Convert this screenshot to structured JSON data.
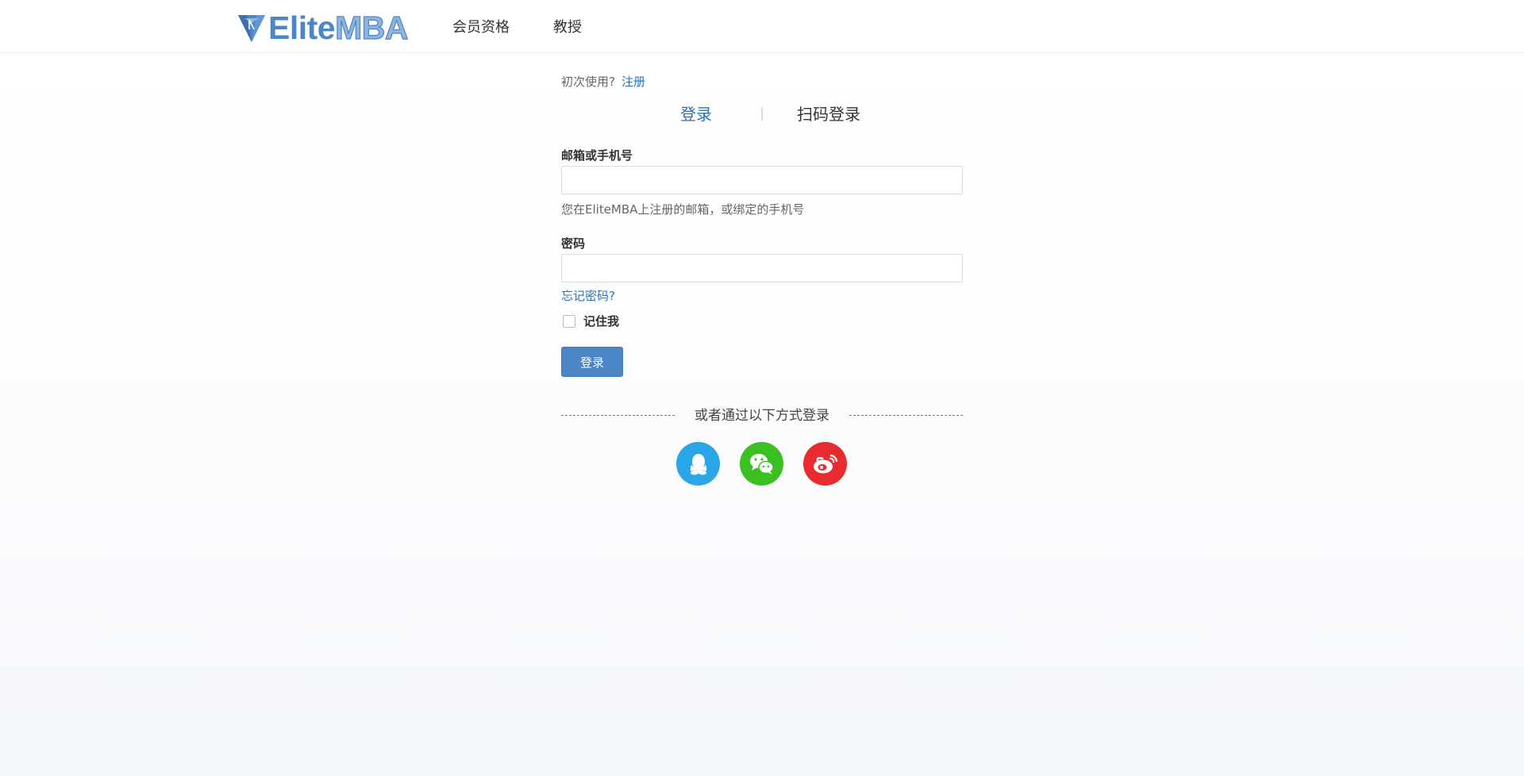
{
  "brand": {
    "logo_part1": "Elite",
    "logo_part2": "MBA",
    "colors": {
      "primary": "#4c86c4",
      "link": "#2a72b5",
      "button": "#4a86c5"
    }
  },
  "nav": {
    "items": [
      {
        "label": "会员资格"
      },
      {
        "label": "教授"
      }
    ]
  },
  "login": {
    "first_use_text": "初次使用?",
    "register_link": "注册",
    "tabs": [
      {
        "label": "登录",
        "active": true
      },
      {
        "label": "扫码登录",
        "active": false
      }
    ],
    "account_label": "邮箱或手机号",
    "account_value": "",
    "account_hint": "您在EliteMBA上注册的邮箱，或绑定的手机号",
    "password_label": "密码",
    "password_value": "",
    "forgot_link": "忘记密码?",
    "remember_label": "记住我",
    "remember_checked": false,
    "submit_label": "登录",
    "alt_login_text": "或者通过以下方式登录",
    "social": [
      {
        "name": "qq",
        "icon": "qq-icon",
        "color": "#2aa6e8"
      },
      {
        "name": "wechat",
        "icon": "wechat-icon",
        "color": "#3ac021"
      },
      {
        "name": "weibo",
        "icon": "weibo-icon",
        "color": "#e82b2f"
      }
    ]
  }
}
